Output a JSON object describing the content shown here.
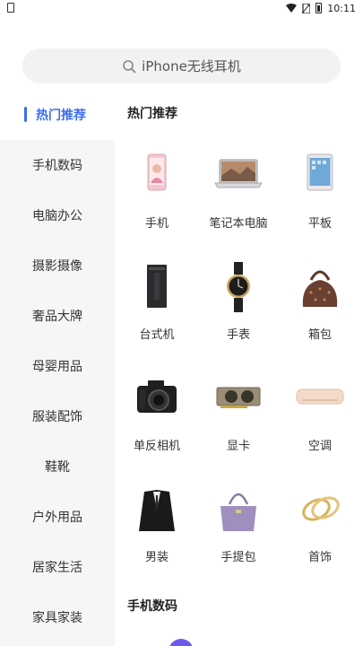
{
  "status_bar": {
    "time": "10:11"
  },
  "search": {
    "placeholder": "iPhone无线耳机"
  },
  "sidebar": {
    "items": [
      {
        "label": "热门推荐",
        "active": true
      },
      {
        "label": "手机数码"
      },
      {
        "label": "电脑办公"
      },
      {
        "label": "摄影摄像"
      },
      {
        "label": "奢品大牌"
      },
      {
        "label": "母婴用品"
      },
      {
        "label": "服装配饰"
      },
      {
        "label": "鞋靴"
      },
      {
        "label": "户外用品"
      },
      {
        "label": "居家生活"
      },
      {
        "label": "家具家装"
      }
    ]
  },
  "main": {
    "section_title": "热门推荐",
    "next_section_title": "手机数码",
    "items": [
      {
        "label": "手机",
        "icon": "smartphone-icon"
      },
      {
        "label": "笔记本电脑",
        "icon": "laptop-icon"
      },
      {
        "label": "平板",
        "icon": "tablet-icon"
      },
      {
        "label": "台式机",
        "icon": "desktop-tower-icon"
      },
      {
        "label": "手表",
        "icon": "watch-icon"
      },
      {
        "label": "箱包",
        "icon": "handbag-icon"
      },
      {
        "label": "单反相机",
        "icon": "dslr-camera-icon"
      },
      {
        "label": "显卡",
        "icon": "graphics-card-icon"
      },
      {
        "label": "空调",
        "icon": "air-conditioner-icon"
      },
      {
        "label": "男装",
        "icon": "suit-icon"
      },
      {
        "label": "手提包",
        "icon": "tote-bag-icon"
      },
      {
        "label": "首饰",
        "icon": "bracelet-icon"
      }
    ]
  }
}
